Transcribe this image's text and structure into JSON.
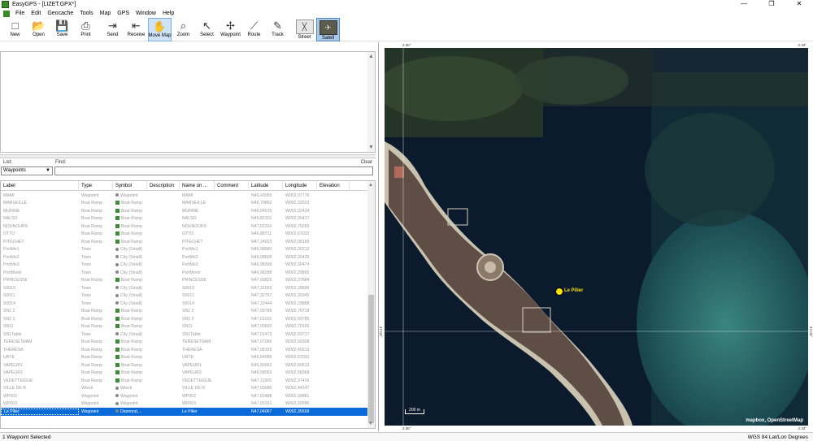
{
  "window": {
    "title": "EasyGPS - [LIZET.GPX*]",
    "controls": [
      "—",
      "❐",
      "✕"
    ]
  },
  "menu": [
    "File",
    "Edit",
    "Geocache",
    "Tools",
    "Map",
    "GPS",
    "Window",
    "Help"
  ],
  "toolbar": [
    {
      "label": "New",
      "icon": "new-file-icon",
      "glyph": "□"
    },
    {
      "label": "Open",
      "icon": "open-folder-icon",
      "glyph": "📂"
    },
    {
      "label": "Save",
      "icon": "save-icon",
      "glyph": "💾"
    },
    {
      "label": "Print",
      "icon": "print-icon",
      "glyph": "⎙"
    },
    {
      "label": "Send",
      "icon": "send-icon",
      "glyph": "⇥"
    },
    {
      "label": "Receive",
      "icon": "receive-icon",
      "glyph": "⇤"
    },
    {
      "label": "Move Map",
      "icon": "hand-icon",
      "glyph": "✋"
    },
    {
      "label": "Zoom",
      "icon": "zoom-icon",
      "glyph": "⌕"
    },
    {
      "label": "Select",
      "icon": "cursor-icon",
      "glyph": "↖"
    },
    {
      "label": "Waypoint",
      "icon": "waypoint-icon",
      "glyph": "✢"
    },
    {
      "label": "Route",
      "icon": "route-icon",
      "glyph": "⟋"
    },
    {
      "label": "Track",
      "icon": "track-icon",
      "glyph": "✎"
    },
    {
      "label": "Street",
      "icon": "street-map-icon",
      "glyph": "╳"
    },
    {
      "label": "Satell",
      "icon": "satellite-map-icon",
      "glyph": "✈"
    }
  ],
  "filter": {
    "list_label": "List:",
    "find_label": "Find:",
    "clear_label": "Clear",
    "list_value": "Waypoints",
    "find_value": ""
  },
  "columns": [
    "Label",
    "Type",
    "Symbol",
    "Description",
    "Name on ...",
    "Comment",
    "Latitude",
    "Longitude",
    "Elevation"
  ],
  "rows": [
    {
      "label": "MAMI",
      "type": "Waypoint",
      "symbol": "Waypoint",
      "sym": "dot",
      "desc": "",
      "name": "MAMI",
      "comment": "",
      "lat": "N46,43055",
      "lon": "W002,07776"
    },
    {
      "label": "MARSEILLE",
      "type": "Boat Ramp",
      "symbol": "Boat Ramp",
      "sym": "g",
      "desc": "",
      "name": "MARSEILLE",
      "comment": "",
      "lat": "N46,70862",
      "lon": "W002,33015"
    },
    {
      "label": "MURINE",
      "type": "Boat Ramp",
      "symbol": "Boat Ramp",
      "sym": "g",
      "desc": "",
      "name": "MURINE",
      "comment": "",
      "lat": "N46,04515",
      "lon": "W002,32434"
    },
    {
      "label": "NALSO",
      "type": "Boat Ramp",
      "symbol": "Boat Ramp",
      "sym": "g",
      "desc": "",
      "name": "NALSO",
      "comment": "",
      "lat": "N46,82115",
      "lon": "W002,35417"
    },
    {
      "label": "NOUNOURS",
      "type": "Boat Ramp",
      "symbol": "Boat Ramp",
      "sym": "g",
      "desc": "",
      "name": "NOUNOURS",
      "comment": "",
      "lat": "N47,01203",
      "lon": "W002,75283"
    },
    {
      "label": "OTTO",
      "type": "Boat Ramp",
      "symbol": "Boat Ramp",
      "sym": "g",
      "desc": "",
      "name": "OTTO",
      "comment": "",
      "lat": "N46,88711",
      "lon": "W002,67033"
    },
    {
      "label": "PITECHET",
      "type": "Boat Ramp",
      "symbol": "Boat Ramp",
      "sym": "g",
      "desc": "",
      "name": "PITECHET",
      "comment": "",
      "lat": "N47,24023",
      "lon": "W002,98189"
    },
    {
      "label": "PortMe1",
      "type": "Town",
      "symbol": "City (Small)",
      "sym": "dot",
      "desc": "",
      "name": "PortMe1",
      "comment": "",
      "lat": "N46,98680",
      "lon": "W002,30212"
    },
    {
      "label": "PortMe2",
      "type": "Town",
      "symbol": "City (Small)",
      "sym": "dot",
      "desc": "",
      "name": "PortMe2",
      "comment": "",
      "lat": "N46,98608",
      "lon": "W002,30425"
    },
    {
      "label": "PortMe3",
      "type": "Town",
      "symbol": "City (Small)",
      "sym": "dot",
      "desc": "",
      "name": "PortMe3",
      "comment": "",
      "lat": "N46,98399",
      "lon": "W002,30474"
    },
    {
      "label": "PortMorin",
      "type": "Town",
      "symbol": "City (Small)",
      "sym": "dot",
      "desc": "",
      "name": "PortMorin",
      "comment": "",
      "lat": "N46,98288",
      "lon": "W002,29865"
    },
    {
      "label": "PRINCESSE",
      "type": "Boat Ramp",
      "symbol": "Boat Ramp",
      "sym": "g",
      "desc": "",
      "name": "PRINCESSE",
      "comment": "",
      "lat": "N47,09825",
      "lon": "W002,37884"
    },
    {
      "label": "S0010",
      "type": "Town",
      "symbol": "City (Small)",
      "sym": "dot",
      "desc": "",
      "name": "S0010",
      "comment": "",
      "lat": "N47,31559",
      "lon": "W002,28896"
    },
    {
      "label": "S0011",
      "type": "Town",
      "symbol": "City (Small)",
      "sym": "dot",
      "desc": "",
      "name": "S0011",
      "comment": "",
      "lat": "N47,32767",
      "lon": "W002,33345"
    },
    {
      "label": "S0014",
      "type": "Town",
      "symbol": "City (Small)",
      "sym": "dot",
      "desc": "",
      "name": "S0014",
      "comment": "",
      "lat": "N47,32444",
      "lon": "W002,29888"
    },
    {
      "label": "SN1 2",
      "type": "Boat Ramp",
      "symbol": "Boat Ramp",
      "sym": "g",
      "desc": "",
      "name": "SN1 2",
      "comment": "",
      "lat": "N47,09788",
      "lon": "W002,70718"
    },
    {
      "label": "SN1 3",
      "type": "Boat Ramp",
      "symbol": "Boat Ramp",
      "sym": "g",
      "desc": "",
      "name": "SN1 3",
      "comment": "",
      "lat": "N47,01163",
      "lon": "W002,69785"
    },
    {
      "label": "SN11",
      "type": "Boat Ramp",
      "symbol": "Boat Ramp",
      "sym": "g",
      "desc": "",
      "name": "SN11",
      "comment": "",
      "lat": "N47,00650",
      "lon": "W002,70165"
    },
    {
      "label": "SN1Table",
      "type": "Town",
      "symbol": "City (Small)",
      "sym": "dot",
      "desc": "",
      "name": "SN1Table",
      "comment": "",
      "lat": "N47,01473",
      "lon": "W002,69717"
    },
    {
      "label": "TERESETHAM",
      "type": "Boat Ramp",
      "symbol": "Boat Ramp",
      "sym": "g",
      "desc": "",
      "name": "TERESETHAM",
      "comment": "",
      "lat": "N47,07066",
      "lon": "W002,60308"
    },
    {
      "label": "THERESA",
      "type": "Boat Ramp",
      "symbol": "Boat Ramp",
      "sym": "g",
      "desc": "",
      "name": "THERESA",
      "comment": "",
      "lat": "N47,08165",
      "lon": "W002,45613"
    },
    {
      "label": "URTE",
      "type": "Boat Ramp",
      "symbol": "Boat Ramp",
      "sym": "g",
      "desc": "",
      "name": "URTE",
      "comment": "",
      "lat": "N46,84085",
      "lon": "W002,67020"
    },
    {
      "label": "VAPEUR1",
      "type": "Boat Ramp",
      "symbol": "Boat Ramp",
      "sym": "g",
      "desc": "",
      "name": "VAPEUR1",
      "comment": "",
      "lat": "N46,56562",
      "lon": "W002,60613"
    },
    {
      "label": "VAPEUR2",
      "type": "Boat Ramp",
      "symbol": "Boat Ramp",
      "sym": "g",
      "desc": "",
      "name": "VAPEUR2",
      "comment": "",
      "lat": "N46,58052",
      "lon": "W002,58368"
    },
    {
      "label": "VEDETTEIGUE",
      "type": "Boat Ramp",
      "symbol": "Boat Ramp",
      "sym": "g",
      "desc": "",
      "name": "VEDETTEIGUE",
      "comment": "",
      "lat": "N47,11565",
      "lon": "W002,37416"
    },
    {
      "label": "VILLE DE R",
      "type": "Wreck",
      "symbol": "Wreck",
      "sym": "dot",
      "desc": "",
      "name": "VILLE DE R",
      "comment": "",
      "lat": "N47,03086",
      "lon": "W002,44147"
    },
    {
      "label": "WP002",
      "type": "Waypoint",
      "symbol": "Waypoint",
      "sym": "dot",
      "desc": "",
      "name": "WP002",
      "comment": "",
      "lat": "N47,02488",
      "lon": "W002,39881"
    },
    {
      "label": "WP003",
      "type": "Waypoint",
      "symbol": "Waypoint",
      "sym": "dot",
      "desc": "",
      "name": "WP003",
      "comment": "",
      "lat": "N47,03151",
      "lon": "W002,32686"
    }
  ],
  "selected_row": {
    "label": "Le Pilier",
    "type": "Waypoint",
    "symbol": "Diamond,...",
    "sym": "dot",
    "desc": "",
    "name": "Le Pilier",
    "comment": "",
    "lat": "N47,04067",
    "lon": "W002,35609"
  },
  "map": {
    "waypoint_label": "Le Pilier",
    "credit": "mapbox, OpenStreetMap",
    "scale_label": "200 m",
    "tick_top_left": "2.36°",
    "tick_top_right": "2.33°",
    "tick_bottom_left": "2.36°",
    "tick_bottom_right": "2.33°",
    "tick_left": "47.04°",
    "tick_right": "47.04°"
  },
  "status": {
    "left": "1 Waypoint Selected",
    "right": "WGS 84 Lat/Lon Degrees"
  }
}
